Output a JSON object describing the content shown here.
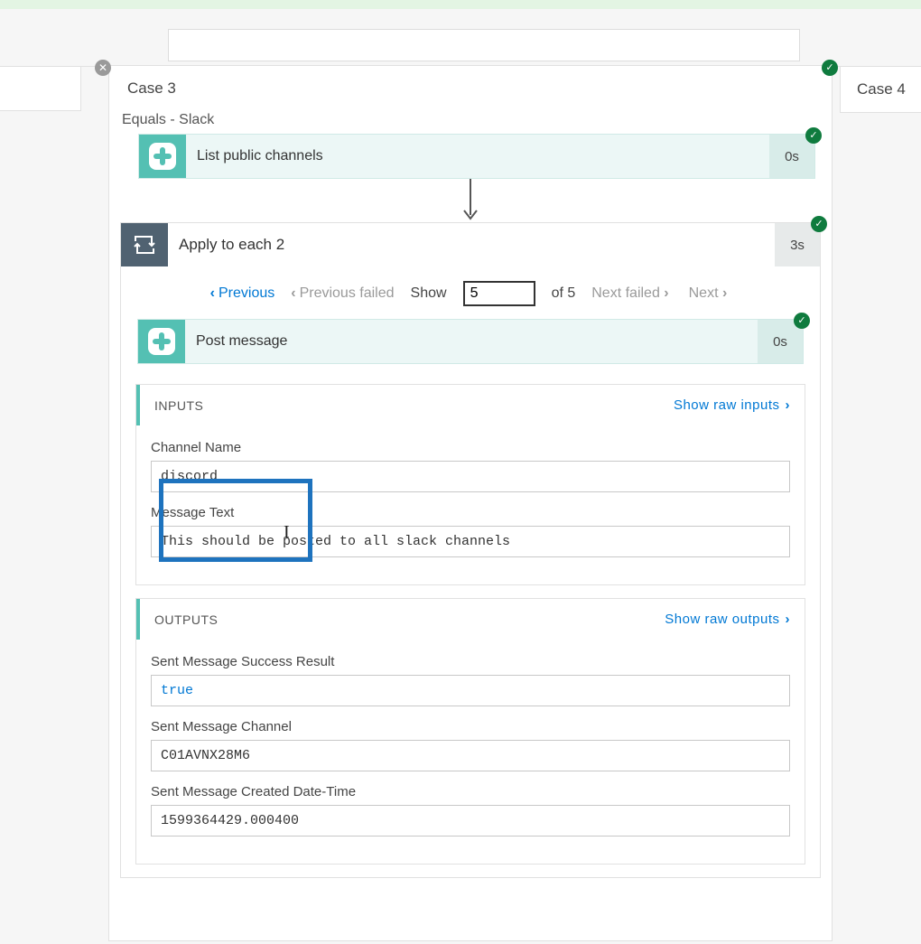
{
  "colors": {
    "slack_teal": "#54c0b3",
    "link_blue": "#0078d4",
    "loop_grey": "#506271",
    "success_green": "#0f7b3e"
  },
  "side_cases": {
    "right_label": "Case 4"
  },
  "case": {
    "title": "Case 3",
    "condition_label": "Equals - Slack",
    "action1": {
      "label": "List public channels",
      "time": "0s"
    },
    "loop": {
      "label": "Apply to each 2",
      "time": "3s",
      "pager": {
        "prev": "Previous",
        "prev_failed": "Previous failed",
        "show_label": "Show",
        "current": "5",
        "of_label": "of 5",
        "next_failed": "Next failed",
        "next": "Next"
      },
      "post": {
        "label": "Post message",
        "time": "0s"
      },
      "inputs": {
        "header": "INPUTS",
        "show_raw": "Show raw inputs",
        "fields": [
          {
            "label": "Channel Name",
            "value": "discord"
          },
          {
            "label": "Message Text",
            "value": "This should be posted to all slack channels"
          }
        ]
      },
      "outputs": {
        "header": "OUTPUTS",
        "show_raw": "Show raw outputs",
        "fields": [
          {
            "label": "Sent Message Success Result",
            "value": "true",
            "value_class": "truetext"
          },
          {
            "label": "Sent Message Channel",
            "value": "C01AVNX28M6"
          },
          {
            "label": "Sent Message Created Date-Time",
            "value": "1599364429.000400"
          }
        ]
      }
    }
  }
}
